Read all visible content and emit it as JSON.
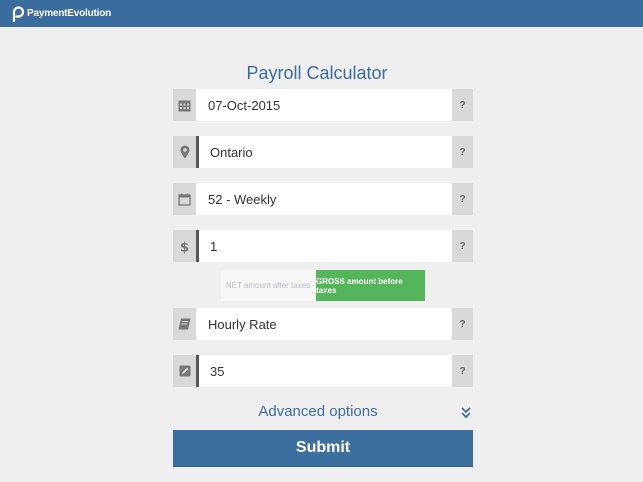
{
  "header": {
    "brand": "PaymentEvolution",
    "bg_color": "#3a6c9e"
  },
  "form": {
    "title": "Payroll Calculator",
    "fields": [
      {
        "name": "date",
        "value": "07-Oct-2015",
        "icon": "calendar-icon"
      },
      {
        "name": "province",
        "value": "Ontario",
        "icon": "map-marker-icon"
      },
      {
        "name": "pay-frequency",
        "value": "52 - Weekly",
        "icon": "calendar-outline-icon"
      },
      {
        "name": "amount",
        "value": "1",
        "icon": "dollar-icon"
      },
      {
        "name": "pay-type",
        "value": "Hourly Rate",
        "icon": "book-icon"
      },
      {
        "name": "hours",
        "value": "35",
        "icon": "pencil-square-icon"
      }
    ],
    "help_label": "?",
    "toggle": {
      "net_label": "NET amount after taxes",
      "gross_label": "GROSS amount before taxes",
      "selected": "gross",
      "selected_color": "#55b55a"
    },
    "advanced_label": "Advanced options",
    "submit_label": "Submit"
  },
  "colors": {
    "accent": "#3d6d9d",
    "background": "#efefef"
  }
}
